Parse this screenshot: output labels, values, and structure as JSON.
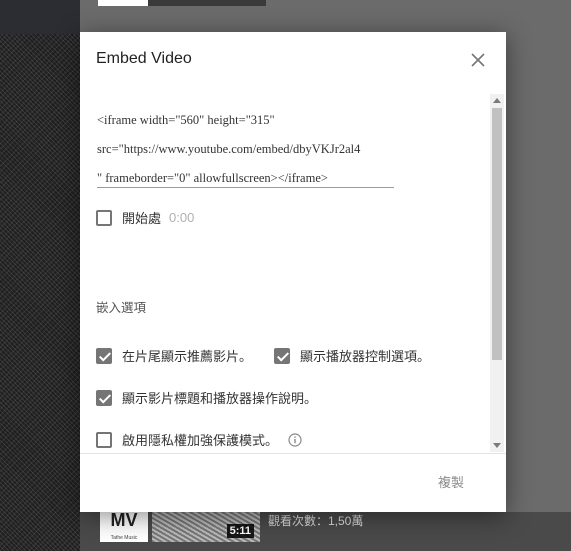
{
  "modal": {
    "title": "Embed Video",
    "embed_lines": [
      "<iframe width=\"560\" height=\"315\"",
      "src=\"https://www.youtube.com/embed/dbyVKJr2al4",
      "\" frameborder=\"0\" allowfullscreen></iframe>"
    ],
    "start_at": {
      "label": "開始處",
      "time": "0:00",
      "checked": false
    },
    "options_heading": "嵌入選項",
    "options": [
      {
        "label": "在片尾顯示推薦影片。",
        "checked": true
      },
      {
        "label": "顯示播放器控制選項。",
        "checked": true
      },
      {
        "label": "顯示影片標題和播放器操作說明。",
        "checked": true
      },
      {
        "label": "啟用隱私權加強保護模式。",
        "checked": false
      }
    ],
    "copy_label": "複製"
  },
  "background": {
    "mv_badge": "MV",
    "mv_sub": "Tathe Music",
    "duration": "5:11",
    "views": "觀看次數：1,50萬"
  },
  "colors": {
    "checkbox": "#757575",
    "overlay": "#6b6b6b"
  }
}
